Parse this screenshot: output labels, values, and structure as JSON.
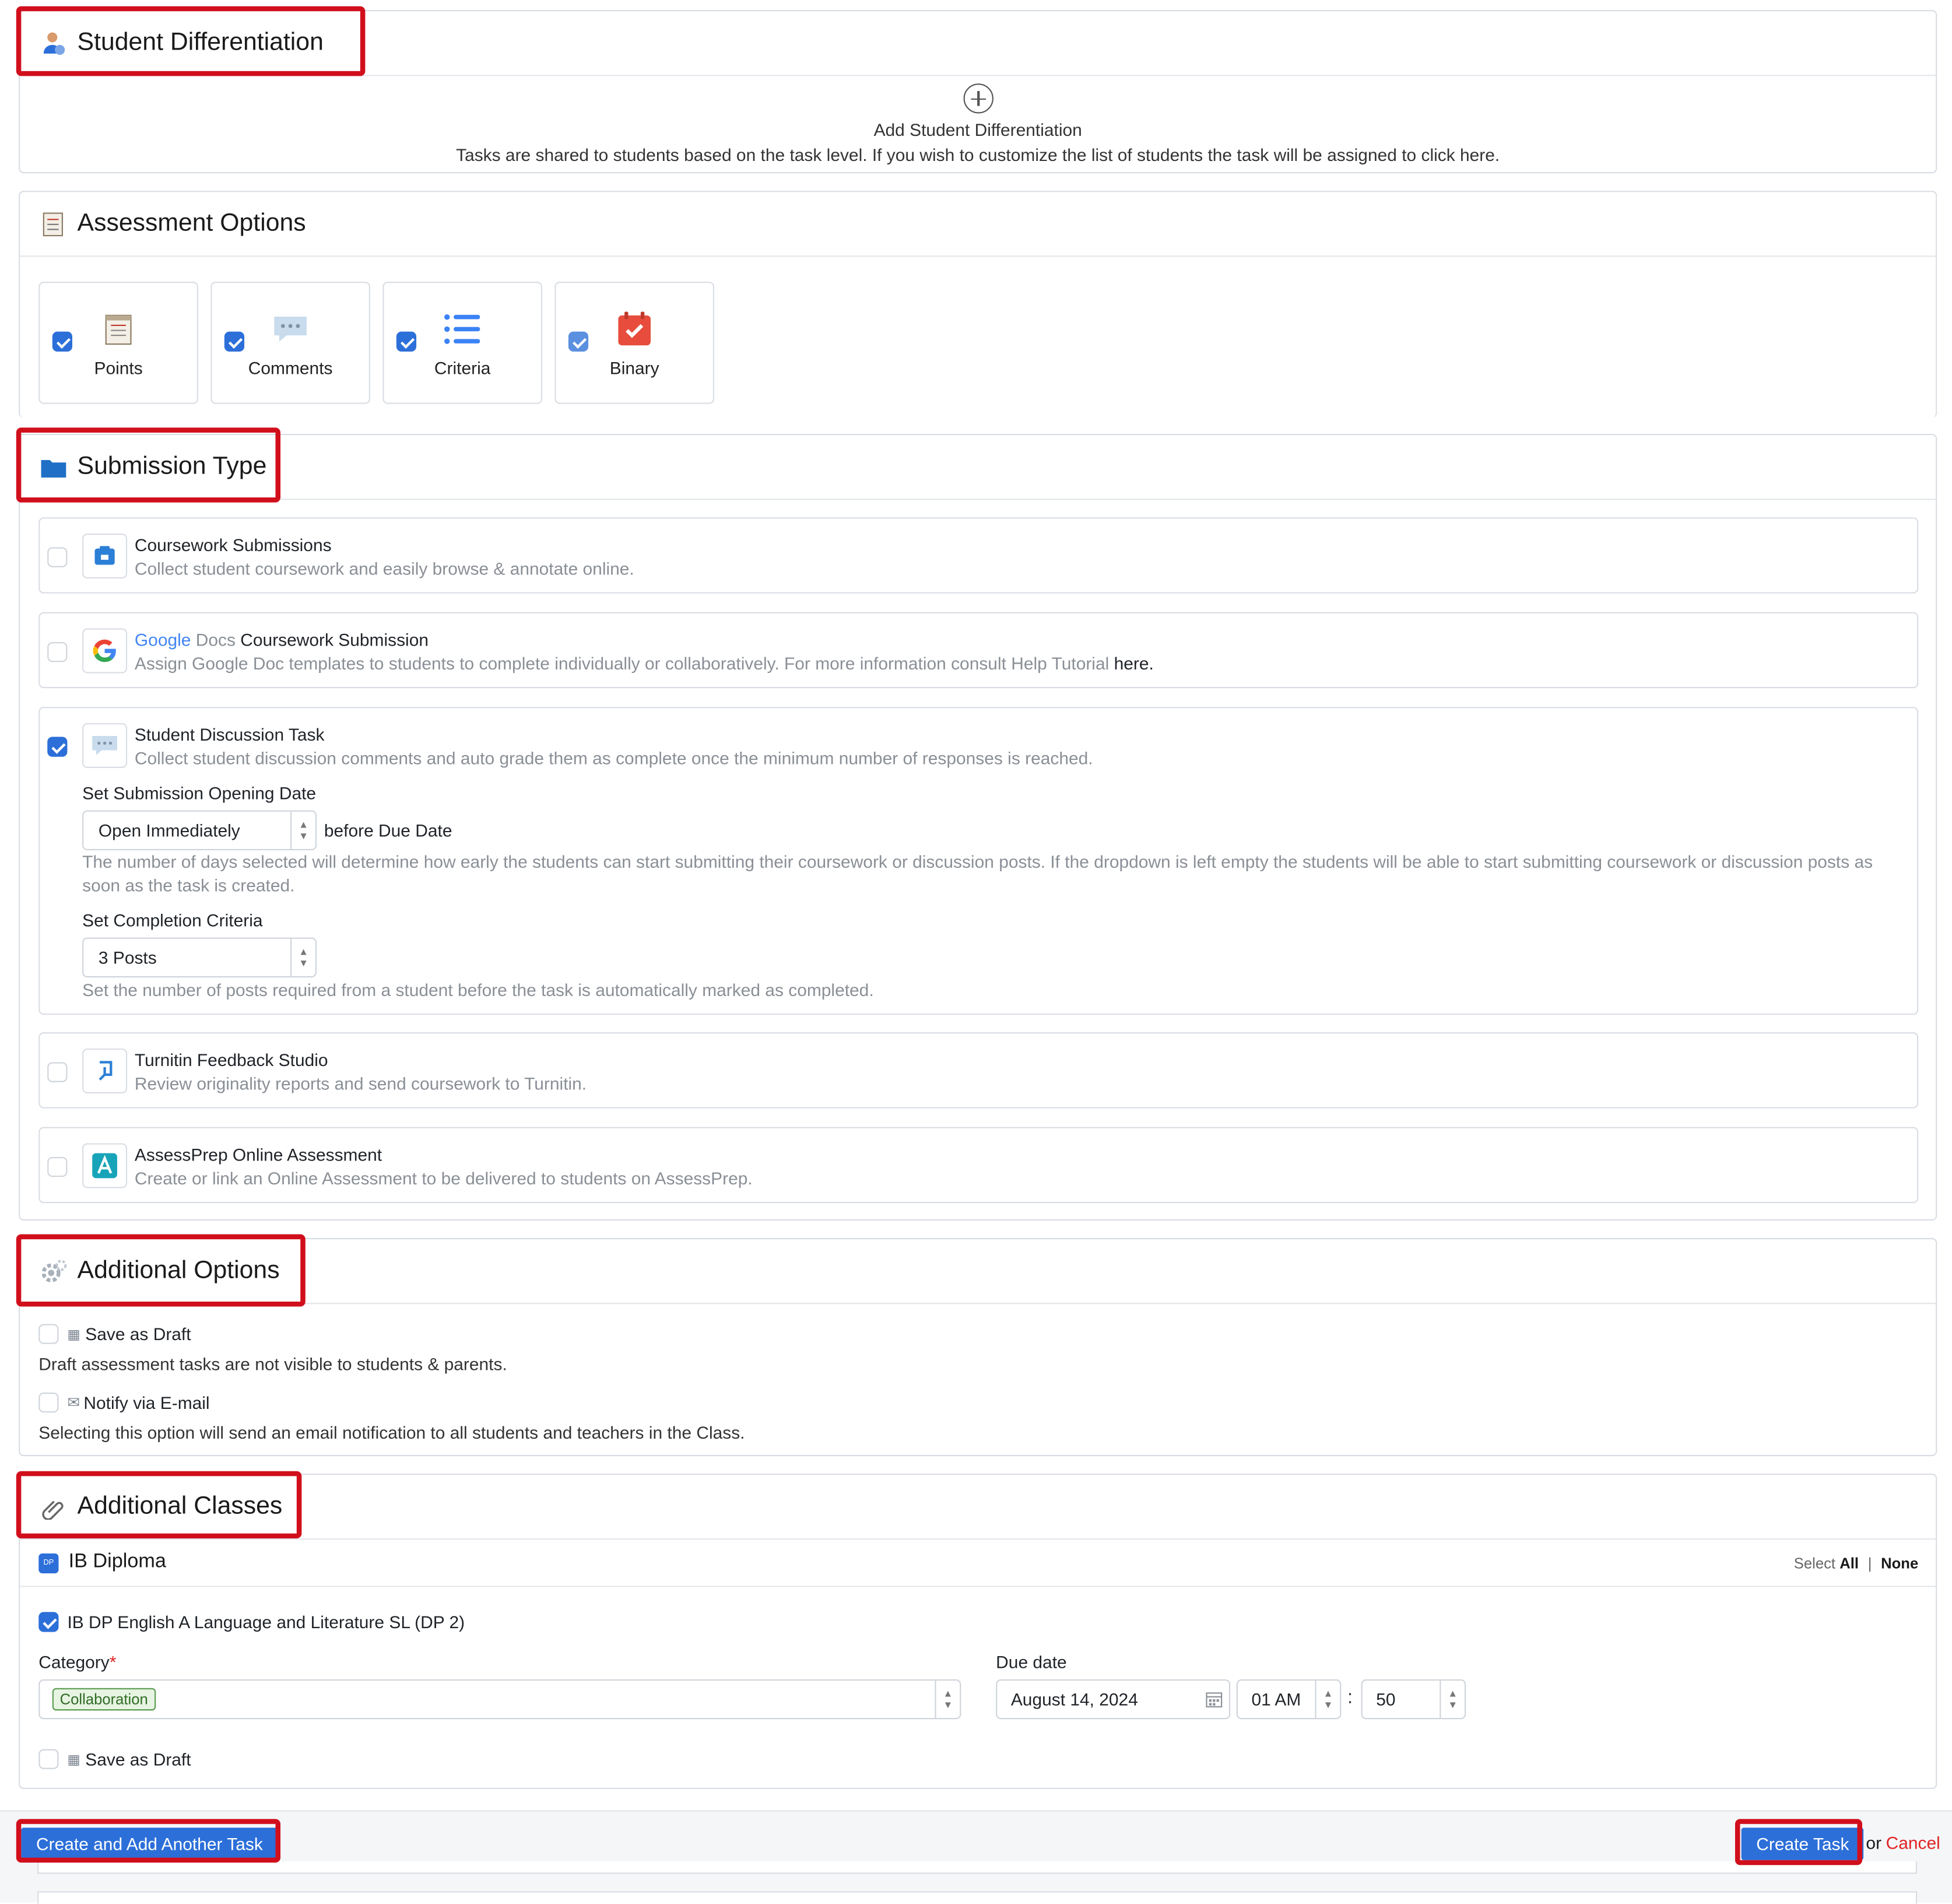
{
  "student_differentiation": {
    "title": "Student Differentiation",
    "add_label": "Add Student Differentiation",
    "description": "Tasks are shared to students based on the task level. If you wish to customize the list of students the task will be assigned to click here."
  },
  "assessment_options": {
    "title": "Assessment Options",
    "items": [
      {
        "label": "Points",
        "checked": true,
        "icon": "notepad-icon"
      },
      {
        "label": "Comments",
        "checked": true,
        "icon": "speech-bubble-icon"
      },
      {
        "label": "Criteria",
        "checked": true,
        "icon": "list-icon"
      },
      {
        "label": "Binary",
        "checked": true,
        "icon": "calendar-check-icon"
      }
    ]
  },
  "submission_type": {
    "title": "Submission Type",
    "items": [
      {
        "title": "Coursework Submissions",
        "description": "Collect student coursework and easily browse & annotate online.",
        "checked": false,
        "icon": "coursework-icon"
      },
      {
        "title_prefix_brand": "Google",
        "title_prefix_docs": "Docs",
        "title": "Coursework Submission",
        "description": "Assign Google Doc templates to students to complete individually or collaboratively. For more information consult Help Tutorial",
        "link": "here",
        "link_suffix": ".",
        "checked": false,
        "icon": "google-icon"
      },
      {
        "title": "Student Discussion Task",
        "description": "Collect student discussion comments and auto grade them as complete once the minimum number of responses is reached.",
        "checked": true,
        "icon": "discussion-icon"
      },
      {
        "title": "Turnitin Feedback Studio",
        "description": "Review originality reports and send coursework to Turnitin.",
        "checked": false,
        "icon": "turnitin-icon"
      },
      {
        "title": "AssessPrep Online Assessment",
        "description": "Create or link an Online Assessment to be delivered to students on AssessPrep.",
        "checked": false,
        "icon": "assessprep-icon"
      }
    ],
    "discussion": {
      "opening_label": "Set Submission Opening Date",
      "opening_value": "Open Immediately",
      "opening_suffix": "before Due Date",
      "opening_help": "The number of days selected will determine how early the students can start submitting their coursework or discussion posts. If the dropdown is left empty the students will be able to start submitting coursework or discussion posts as soon as the task is created.",
      "completion_label": "Set Completion Criteria",
      "completion_value": "3 Posts",
      "completion_help": "Set the number of posts required from a student before the task is automatically marked as completed."
    }
  },
  "additional_options": {
    "title": "Additional Options",
    "save_draft_label": "Save as Draft",
    "save_draft_desc": "Draft assessment tasks are not visible to students & parents.",
    "notify_label": "Notify via E-mail",
    "notify_desc": "Selecting this option will send an email notification to all students and teachers in the Class."
  },
  "additional_classes": {
    "title": "Additional Classes",
    "program": "IB Diploma",
    "dp_badge": "DP",
    "select_label": "Select",
    "select_all": "All",
    "select_sep": "|",
    "select_none": "None",
    "class_name": "IB DP English A Language and Literature SL (DP 2)",
    "class_checked": true,
    "category_label": "Category",
    "required_mark": "*",
    "category_tag": "Collaboration",
    "due_label": "Due date",
    "due_date": "August 14, 2024",
    "hour": "01 AM",
    "time_sep": ":",
    "minute": "50",
    "save_draft_label": "Save as Draft"
  },
  "footer": {
    "create_another": "Create and Add Another Task",
    "create": "Create Task",
    "or": "or",
    "cancel": "Cancel"
  },
  "colors": {
    "primary": "#2c6fd9",
    "highlight": "#d10f1c",
    "cancel": "#e02424"
  }
}
